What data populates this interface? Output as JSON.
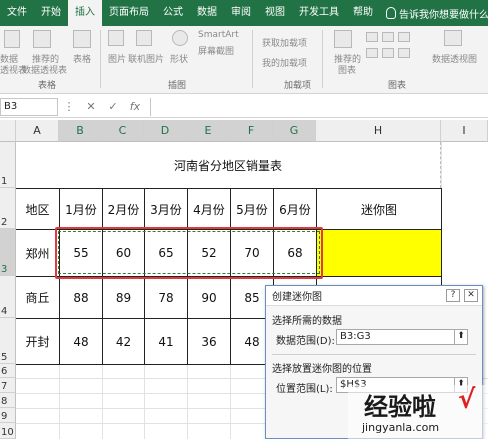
{
  "ribbon_tabs": [
    "文件",
    "开始",
    "插入",
    "页面布局",
    "公式",
    "数据",
    "审阅",
    "视图",
    "开发工具",
    "帮助"
  ],
  "active_tab": "插入",
  "tell_me": "告诉我你想要做什么",
  "ribbon": {
    "table_btn_1": "数据",
    "table_btn_1b": "透视表",
    "table_btn_2": "推荐的",
    "table_btn_2b": "数据透视表",
    "table_btn_3": "表格",
    "group_tables": "表格",
    "illus_pictures": "图片",
    "illus_online": "联机图片",
    "illus_shapes": "形状",
    "illus_smartart": "SmartArt",
    "illus_screenshot": "屏幕截图",
    "group_illustrations": "插图",
    "addin_get": "获取加载项",
    "addin_mine": "我的加载项",
    "group_addins": "加载项",
    "charts_recommended": "推荐的",
    "charts_recommended_b": "图表",
    "group_charts": "图表",
    "pivot_chart": "数据透视图"
  },
  "formula_bar": {
    "name_box": "B3",
    "cancel": "✕",
    "enter": "✓",
    "fx": "fx"
  },
  "columns": [
    "A",
    "B",
    "C",
    "D",
    "E",
    "F",
    "G",
    "H",
    "I"
  ],
  "rows": [
    "1",
    "2",
    "3",
    "4",
    "5",
    "6",
    "7",
    "8",
    "9",
    "10"
  ],
  "sheet": {
    "title": "河南省分地区销量表",
    "header": [
      "地区",
      "1月份",
      "2月份",
      "3月份",
      "4月份",
      "5月份",
      "6月份",
      "迷你图"
    ],
    "data": [
      {
        "region": "郑州",
        "values": [
          "55",
          "60",
          "65",
          "52",
          "70",
          "68"
        ]
      },
      {
        "region": "商丘",
        "values": [
          "88",
          "89",
          "78",
          "90",
          "85"
        ]
      },
      {
        "region": "开封",
        "values": [
          "48",
          "42",
          "41",
          "36",
          "48"
        ]
      }
    ],
    "highlight_color": "#ffff00",
    "selection_color": "#e0393e"
  },
  "dialog": {
    "title": "创建迷你图",
    "help": "?",
    "close": "✕",
    "section1": "选择所需的数据",
    "field1_label": "数据范围(D):",
    "field1_value": "B3:G3",
    "section2": "选择放置迷你图的位置",
    "field2_label": "位置范围(L):",
    "field2_value": "$H$3"
  },
  "watermark": {
    "text": "经验啦",
    "url": "jingyanla.com"
  }
}
